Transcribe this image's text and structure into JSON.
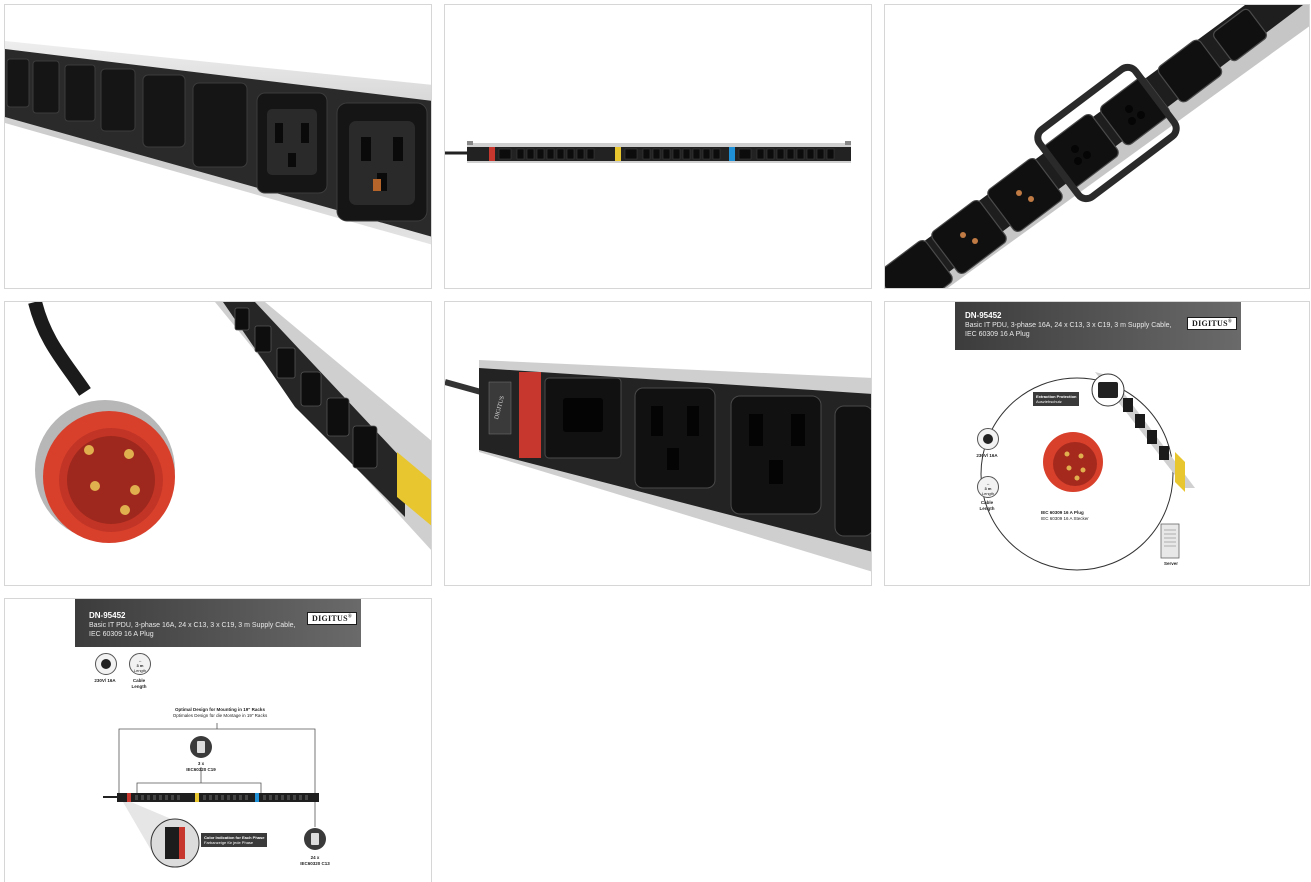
{
  "gallery": {
    "images": [
      {
        "name": "angled-close-up-of-c13-c19-sockets"
      },
      {
        "name": "full-pdu-strip-front"
      },
      {
        "name": "diagonal-c13-sockets-with-locking-frame"
      },
      {
        "name": "red-cee-plug-and-strip"
      },
      {
        "name": "pdu-end-with-digitus-label"
      },
      {
        "name": "infographic-extraction-protection"
      },
      {
        "name": "infographic-rack-mounting"
      }
    ]
  },
  "infographic_a": {
    "model": "DN-95452",
    "description": "Basic IT PDU, 3-phase 16A, 24 x C13, 3 x C19, 3 m Supply Cable, IEC 60309 16 A Plug",
    "brand": "DIGITUS",
    "brand_mark": "®",
    "extraction_title": "Extraction Protection",
    "extraction_sub": "Auszieh­schutz",
    "voltage_label": "230V/ 16A",
    "cable_icon_text": "3 m",
    "cable_icon_sub": "Length",
    "cable_label_1": "Cable",
    "cable_label_2": "Length",
    "plug_title": "IEC 60309 16 A Plug",
    "plug_sub": "IEC 60309 16 A Stecker",
    "server_label": "Server"
  },
  "infographic_b": {
    "model": "DN-95452",
    "description_line1": "Basic IT PDU, 3-phase 16A, 24 x C13, 3 x C19, 3 m Supply Cable,",
    "description_line2": "IEC 60309 16 A Plug",
    "brand": "DIGITUS",
    "brand_mark": "®",
    "voltage_label": "230V/ 16A",
    "cable_icon_text": "3 m",
    "cable_icon_sub": "Length",
    "cable_label_1": "Cable",
    "cable_label_2": "Length",
    "rack_title": "Optimal Design for Mounting in 19\" Racks",
    "rack_sub": "Optimales Design für die Montage in 19\" Racks",
    "c19_count": "3 x",
    "c19_label": "IEC60320 C19",
    "phase_title": "Color Indication for Each Phase",
    "phase_sub": "Farbanzeige für jede Phase",
    "c13_count": "24 x",
    "c13_label": "IEC60320 C13"
  },
  "colors": {
    "phase1": "#c8372d",
    "phase2": "#e8c630",
    "phase3": "#1f8fd6",
    "plug_red": "#d8402c",
    "aluminium": "#cfcfcf",
    "socket_black": "#1c1c1c"
  }
}
